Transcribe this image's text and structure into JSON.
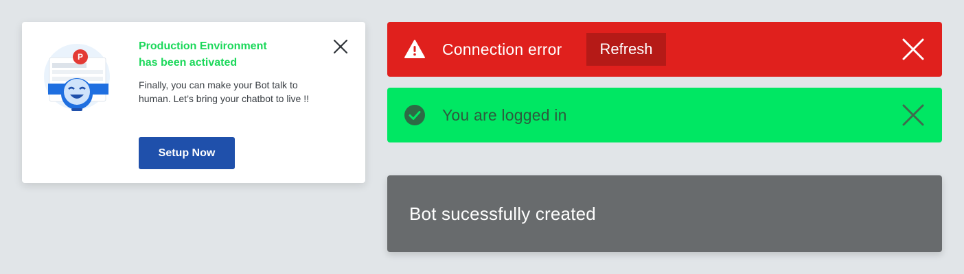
{
  "notification_card": {
    "badge_letter": "P",
    "title_line1": "Production Environment",
    "title_line2": "has been activated",
    "body": "Finally, you can make your Bot talk to human. Let’s bring your chatbot to live !!",
    "cta_label": "Setup Now",
    "close_icon": "close-icon",
    "colors": {
      "title": "#1bd85a",
      "cta": "#1f50ab"
    }
  },
  "toasts": {
    "error": {
      "icon": "warning-icon",
      "message": "Connection error",
      "action_label": "Refresh",
      "color": "#e0201d"
    },
    "success": {
      "icon": "check-circle-icon",
      "message": "You are logged in",
      "color": "#00e763"
    },
    "neutral": {
      "message": "Bot sucessfully created",
      "color": "#686b6d"
    }
  }
}
